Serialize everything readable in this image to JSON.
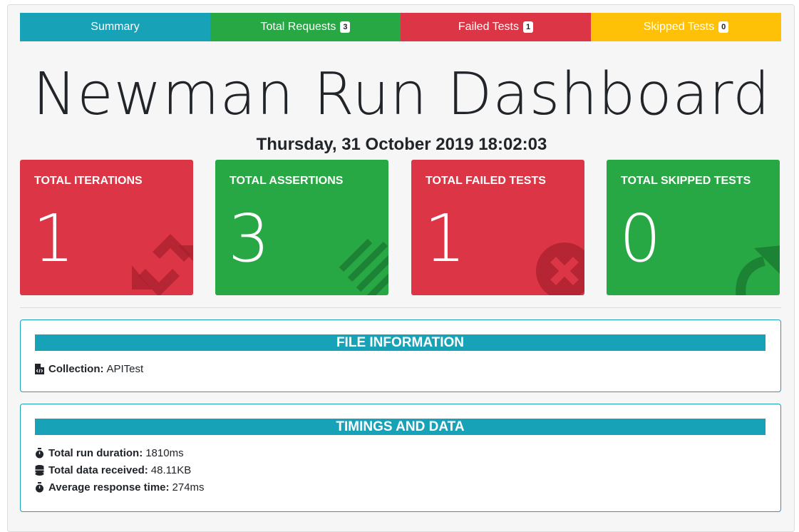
{
  "tabs": [
    {
      "label": "Summary",
      "badge": ""
    },
    {
      "label": "Total Requests",
      "badge": "3"
    },
    {
      "label": "Failed Tests",
      "badge": "1"
    },
    {
      "label": "Skipped Tests",
      "badge": "0"
    }
  ],
  "title": "Newman Run Dashboard",
  "date": "Thursday, 31 October 2019 18:02:03",
  "cards": [
    {
      "label": "TOTAL ITERATIONS",
      "value": "1",
      "icon": "sync-icon"
    },
    {
      "label": "TOTAL ASSERTIONS",
      "value": "3",
      "icon": "tasks-icon"
    },
    {
      "label": "TOTAL FAILED TESTS",
      "value": "1",
      "icon": "times-circle-icon"
    },
    {
      "label": "TOTAL SKIPPED TESTS",
      "value": "0",
      "icon": "share-arrow-icon"
    }
  ],
  "file_info": {
    "heading": "FILE INFORMATION",
    "collection_label": "Collection:",
    "collection_value": "APITest"
  },
  "timings": {
    "heading": "TIMINGS AND DATA",
    "duration_label": "Total run duration:",
    "duration_value": "1810ms",
    "data_label": "Total data received:",
    "data_value": "48.11KB",
    "avg_label": "Average response time:",
    "avg_value": "274ms"
  },
  "colors": {
    "info": "#17a2b8",
    "success": "#28a745",
    "danger": "#dc3545",
    "warning": "#ffc107"
  }
}
